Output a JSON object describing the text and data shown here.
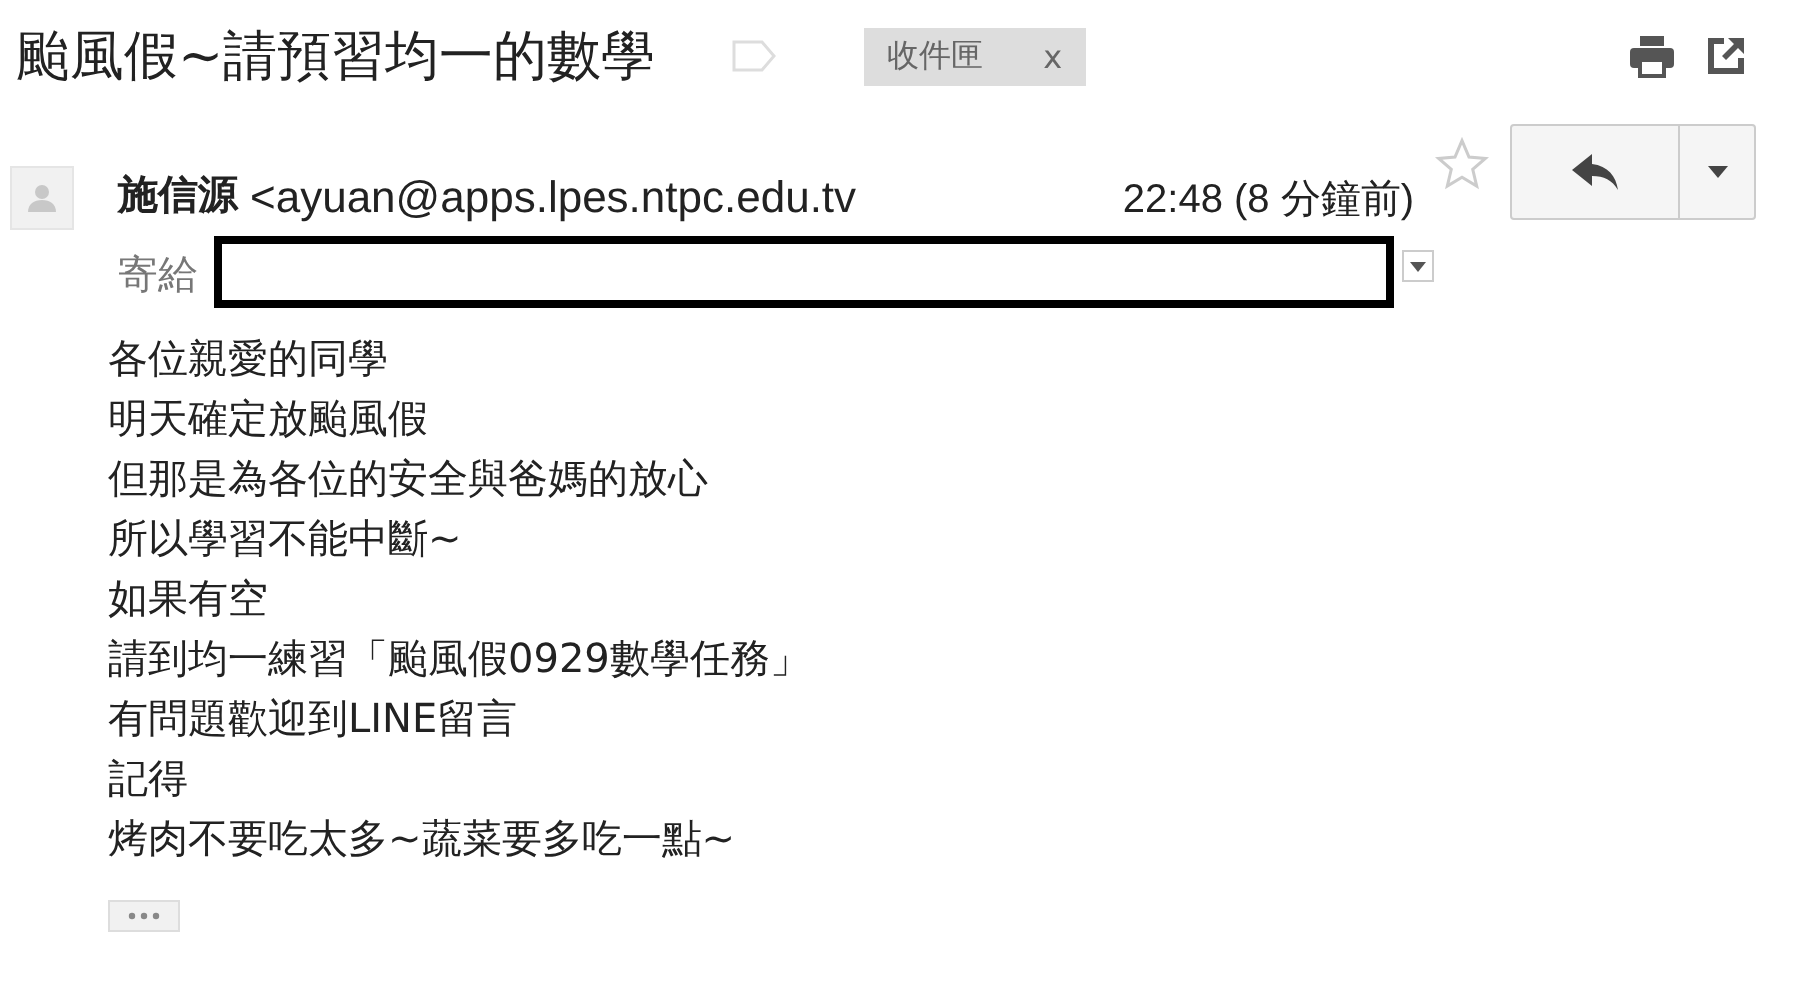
{
  "subject": "颱風假~請預習均一的數學",
  "labels": [
    {
      "text": "收件匣",
      "remove": "x"
    }
  ],
  "message": {
    "sender_name": "施信源",
    "sender_email": "<ayuan@apps.lpes.ntpc.edu.tv",
    "time": "22:48 (8 分鐘前)",
    "starred": false,
    "to_label": "寄給",
    "body": [
      "各位親愛的同學",
      "明天確定放颱風假",
      "但那是為各位的安全與爸媽的放心",
      "所以學習不能中斷~",
      "如果有空",
      "請到均一練習「颱風假0929數學任務」",
      "有問題歡迎到LINE留言",
      "記得",
      "烤肉不要吃太多~蔬菜要多吃一點~"
    ]
  }
}
